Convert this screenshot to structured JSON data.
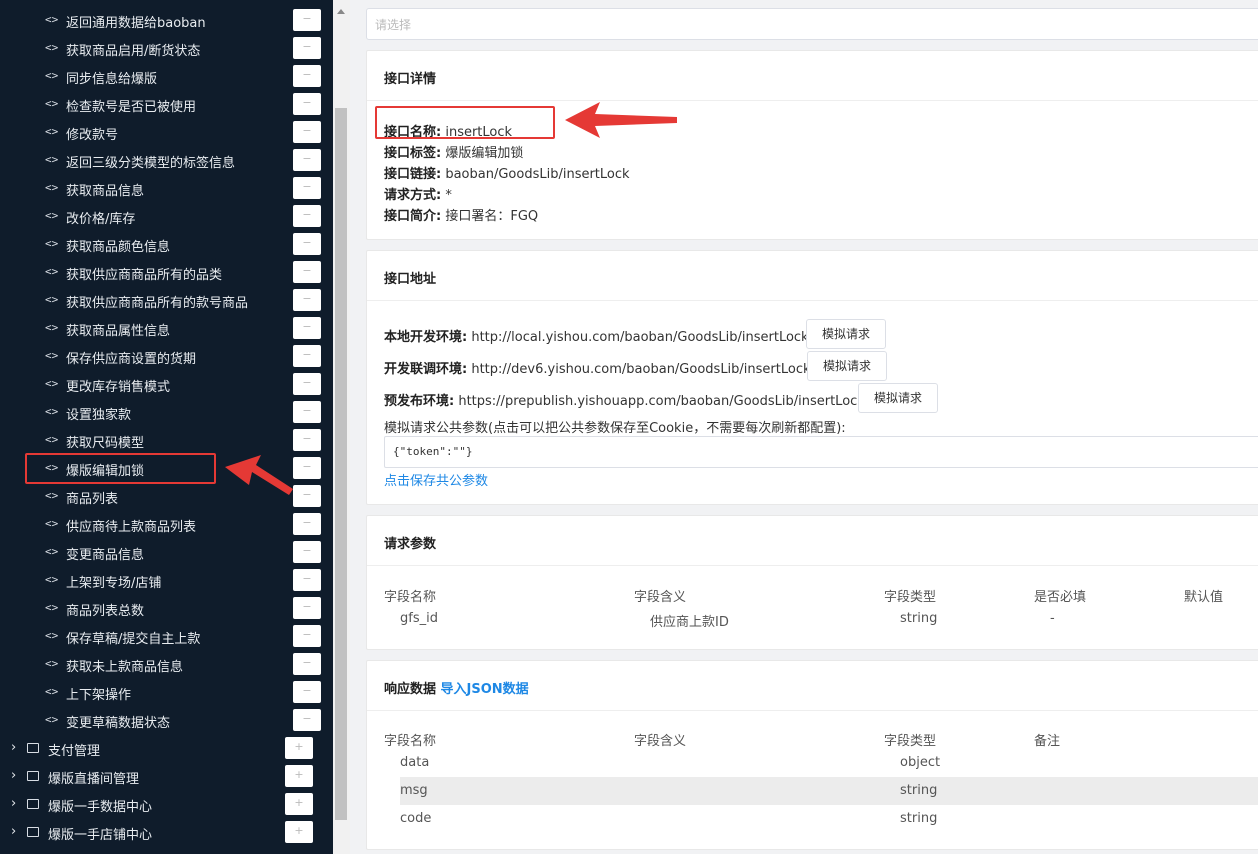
{
  "sidebar": {
    "items": [
      "返回通用数据给baoban",
      "获取商品启用/断货状态",
      "同步信息给爆版",
      "检查款号是否已被使用",
      "修改款号",
      "返回三级分类模型的标签信息",
      "获取商品信息",
      "改价格/库存",
      "获取商品颜色信息",
      "获取供应商商品所有的品类",
      "获取供应商商品所有的款号商品",
      "获取商品属性信息",
      "保存供应商设置的货期",
      "更改库存销售模式",
      "设置独家款",
      "获取尺码模型",
      "爆版编辑加锁",
      "商品列表",
      "供应商待上款商品列表",
      "变更商品信息",
      "上架到专场/店铺",
      "商品列表总数",
      "保存草稿/提交自主上款",
      "获取未上款商品信息",
      "上下架操作",
      "变更草稿数据状态"
    ],
    "link_glyph": "<>",
    "minus_glyph": "−",
    "plus_glyph": "+",
    "groups": [
      "支付管理",
      "爆版直播间管理",
      "爆版一手数据中心",
      "爆版一手店铺中心"
    ],
    "selected": "爆版编辑加锁"
  },
  "select": {
    "placeholder": "请选择"
  },
  "detail": {
    "title": "接口详情",
    "name_key": "接口名称:",
    "name_val": "insertLock",
    "tag_key": "接口标签:",
    "tag_val": "爆版编辑加锁",
    "link_key": "接口链接:",
    "link_val": "baoban/GoodsLib/insertLock",
    "method_key": "请求方式:",
    "method_val": "*",
    "intro_key": "接口简介:",
    "intro_val": "接口署名：FGQ"
  },
  "address": {
    "title": "接口地址",
    "local_key": "本地开发环境:",
    "local_val": "http://local.yishou.com/baoban/GoodsLib/insertLock",
    "dev_key": "开发联调环境:",
    "dev_val": "http://dev6.yishou.com/baoban/GoodsLib/insertLock",
    "pre_key": "预发布环境:",
    "pre_val": "https://prepublish.yishouapp.com/baoban/GoodsLib/insertLock",
    "simulate_label": "模拟请求",
    "params_hint": "模拟请求公共参数(点击可以把公共参数保存至Cookie，不需要每次刷新都配置):",
    "params_value": "{\"token\":\"\"}",
    "save_link": "点击保存共公参数"
  },
  "request": {
    "title": "请求参数",
    "columns": [
      "字段名称",
      "字段含义",
      "字段类型",
      "是否必填",
      "默认值"
    ],
    "rows": [
      [
        "gfs_id",
        "供应商上款ID",
        "string",
        "-",
        ""
      ]
    ]
  },
  "response": {
    "title": "响应数据",
    "import_link": "导入JSON数据",
    "columns": [
      "字段名称",
      "字段含义",
      "字段类型",
      "备注"
    ],
    "rows": [
      [
        "data",
        "",
        "object",
        ""
      ],
      [
        "msg",
        "",
        "string",
        ""
      ],
      [
        "code",
        "",
        "string",
        ""
      ]
    ]
  },
  "colors": {
    "sidebar_bg": "#0f1c2b",
    "highlight": "#e53935",
    "link": "#1e88e5"
  }
}
